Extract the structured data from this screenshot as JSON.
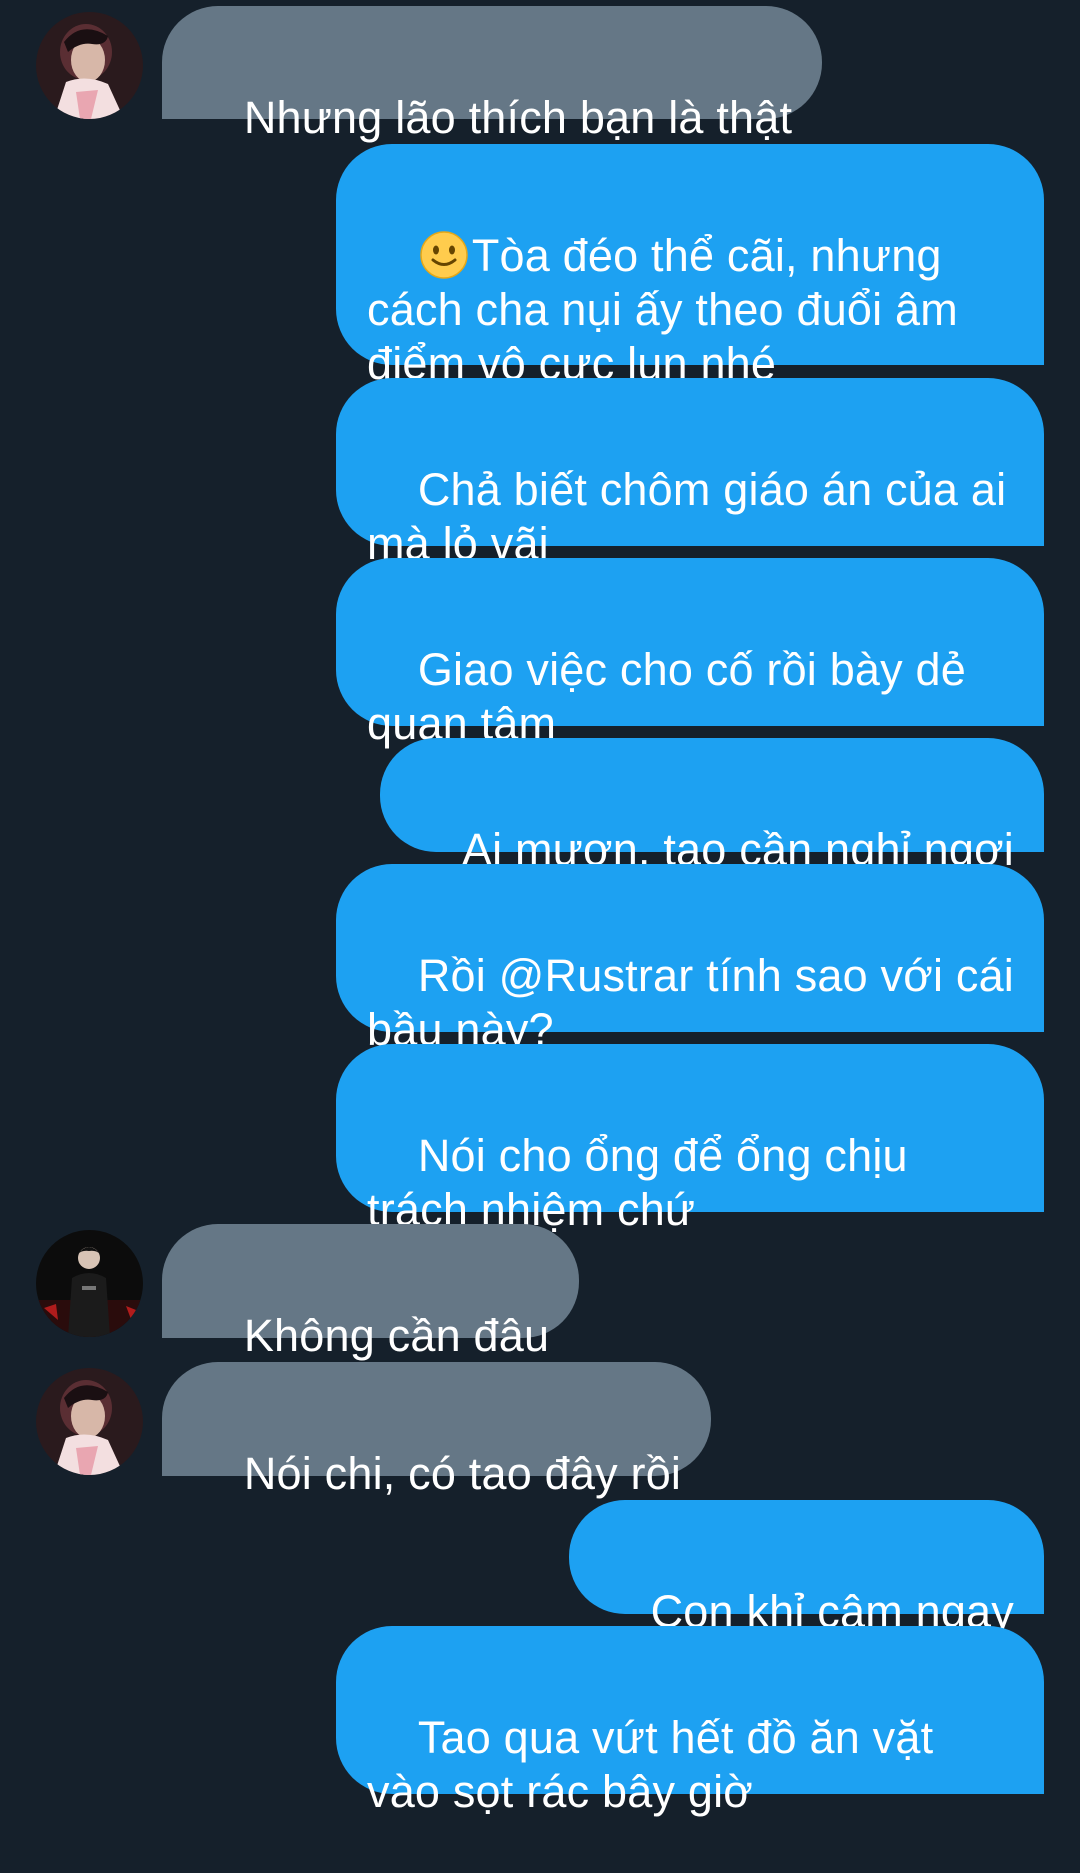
{
  "thread": {
    "messages": [
      {
        "side": "in",
        "author": "friend-a",
        "text": "Nhưng lão thích bạn là thật"
      },
      {
        "side": "out",
        "emoji": "slightly-smiling-face",
        "text": "Tòa đéo thể cãi, nhưng cách cha nụi ấy theo đuổi âm điểm vô cực lun nhé"
      },
      {
        "side": "out",
        "text": "Chả biết chôm giáo án của ai mà lỏ vãi"
      },
      {
        "side": "out",
        "text": "Giao việc cho cố rồi bày dẻ quan tâm"
      },
      {
        "side": "out",
        "text": "Ai mượn, tao cần nghỉ ngơi"
      },
      {
        "side": "out",
        "text": "Rồi @Rustrar tính sao với cái bầu này?"
      },
      {
        "side": "out",
        "text": "Nói cho ổng để ổng chịu trách nhiệm chứ"
      },
      {
        "side": "in",
        "author": "friend-b",
        "text": "Không cần đâu"
      },
      {
        "side": "in",
        "author": "friend-a",
        "text": "Nói chi, có tao đây rồi"
      },
      {
        "side": "out",
        "text": "Con khỉ câm ngay"
      },
      {
        "side": "out",
        "text": "Tao qua vứt hết đồ ăn vặt vào sọt rác bây giờ"
      }
    ]
  },
  "colors": {
    "background": "#15202b",
    "incoming_bubble": "#657786",
    "outgoing_bubble": "#1da1f2",
    "text": "#ffffff"
  }
}
